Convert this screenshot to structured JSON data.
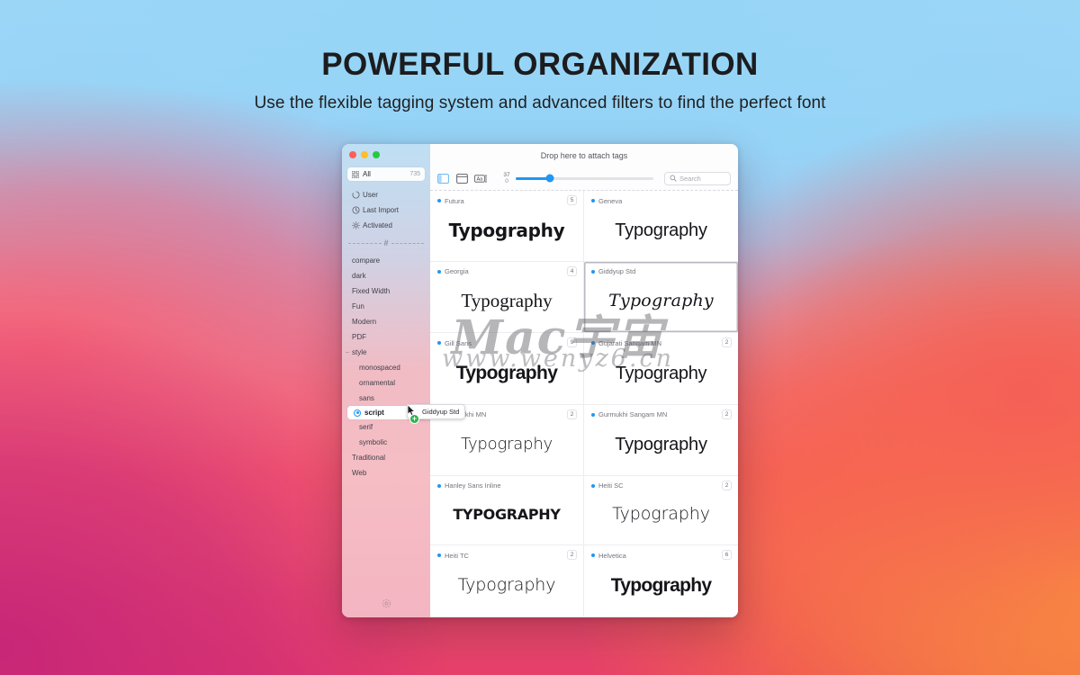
{
  "hero": {
    "headline": "POWERFUL ORGANIZATION",
    "subhead": "Use the flexible tagging system and advanced filters to find the perfect font"
  },
  "watermark": {
    "main": "Mac宇宙",
    "sub": "www.wenyz6.cn"
  },
  "sidebar": {
    "all": {
      "label": "All",
      "count": "735",
      "icon": "grid-icon"
    },
    "smart_lists": [
      {
        "label": "User",
        "icon": "user-icon"
      },
      {
        "label": "Last Import",
        "icon": "clock-icon"
      },
      {
        "label": "Activated",
        "icon": "sun-icon"
      }
    ],
    "divider_glyph": "#",
    "tags": [
      {
        "label": "compare",
        "level": 0,
        "selected": false
      },
      {
        "label": "dark",
        "level": 0,
        "selected": false
      },
      {
        "label": "Fixed Width",
        "level": 0,
        "selected": false
      },
      {
        "label": "Fun",
        "level": 0,
        "selected": false
      },
      {
        "label": "Modern",
        "level": 0,
        "selected": false
      },
      {
        "label": "PDF",
        "level": 0,
        "selected": false
      },
      {
        "label": "style",
        "level": 0,
        "selected": false,
        "disclosure": "–"
      },
      {
        "label": "monospaced",
        "level": 1,
        "selected": false
      },
      {
        "label": "ornamental",
        "level": 1,
        "selected": false
      },
      {
        "label": "sans",
        "level": 1,
        "selected": false
      },
      {
        "label": "script",
        "level": 1,
        "selected": true
      },
      {
        "label": "serif",
        "level": 1,
        "selected": false
      },
      {
        "label": "symbolic",
        "level": 1,
        "selected": false
      },
      {
        "label": "Traditional",
        "level": 0,
        "selected": false
      },
      {
        "label": "Web",
        "level": 0,
        "selected": false
      }
    ],
    "footer_icon": "settings-gear-icon"
  },
  "main": {
    "drop_title": "Drop here to attach tags",
    "toolbar": {
      "sidebar_toggle_icon": "sidebar-toggle-icon",
      "view_mode_icon": "card-view-icon",
      "sample_text_icon": "aa-text-icon",
      "slider": {
        "value": "37",
        "min": "0",
        "percent": 25
      },
      "search_placeholder": "Search"
    },
    "fonts": [
      {
        "name": "Futura",
        "badge": "5",
        "sample": "Typography",
        "style": "s-futura",
        "selected": false
      },
      {
        "name": "Geneva",
        "badge": "",
        "sample": "Typography",
        "style": "s-geneva",
        "selected": false
      },
      {
        "name": "Georgia",
        "badge": "4",
        "sample": "Typography",
        "style": "s-georgia",
        "selected": false
      },
      {
        "name": "Giddyup Std",
        "badge": "",
        "sample": "Typography",
        "style": "s-script",
        "selected": true
      },
      {
        "name": "Gill Sans",
        "badge": "9",
        "sample": "Typography",
        "style": "s-gill",
        "selected": false
      },
      {
        "name": "Gujarati Sangam MN",
        "badge": "2",
        "sample": "Typography",
        "style": "s-guj",
        "selected": false
      },
      {
        "name": "Gurmukhi MN",
        "badge": "2",
        "sample": "Typography",
        "style": "s-mn",
        "selected": false
      },
      {
        "name": "Gurmukhi Sangam MN",
        "badge": "2",
        "sample": "Typography",
        "style": "s-gur",
        "selected": false
      },
      {
        "name": "Hanley Sans Inline",
        "badge": "",
        "sample": "TYPOGRAPHY",
        "style": "s-inline",
        "selected": false
      },
      {
        "name": "Heiti SC",
        "badge": "2",
        "sample": "Typography",
        "style": "s-heiti",
        "selected": false
      },
      {
        "name": "Heiti TC",
        "badge": "2",
        "sample": "Typography",
        "style": "s-heititc",
        "selected": false
      },
      {
        "name": "Helvetica",
        "badge": "6",
        "sample": "Typography",
        "style": "s-helv",
        "selected": false
      }
    ]
  },
  "drag": {
    "label": "Giddyup Std",
    "badge": "+"
  },
  "colors": {
    "accent": "#2196f3",
    "drag_badge": "#28b34b",
    "traffic_red": "#ff5f57",
    "traffic_yellow": "#ffbd2e",
    "traffic_green": "#28c840"
  }
}
